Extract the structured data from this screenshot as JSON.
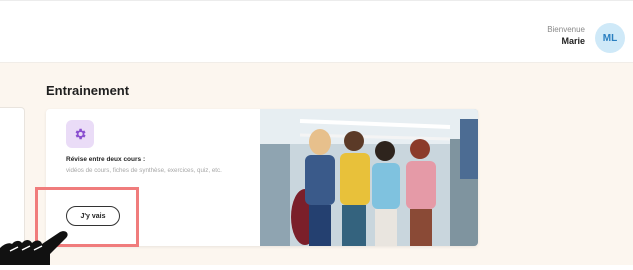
{
  "header": {
    "welcome_label": "Bienvenue",
    "user_name": "Marie",
    "avatar_initials": "ML"
  },
  "section": {
    "title": "Entrainement"
  },
  "card": {
    "heading": "Révise entre deux cours :",
    "description": "vidéos de cours, fiches de synthèse, exercices, quiz, etc.",
    "cta_label": "J'y vais",
    "icon": "gear-icon",
    "image": "students-photo"
  },
  "colors": {
    "page_bg": "#fcf6ef",
    "avatar_bg": "#cfe9f8",
    "icon_tile_bg": "#eadcf7",
    "highlight_border": "#f07c7c"
  }
}
